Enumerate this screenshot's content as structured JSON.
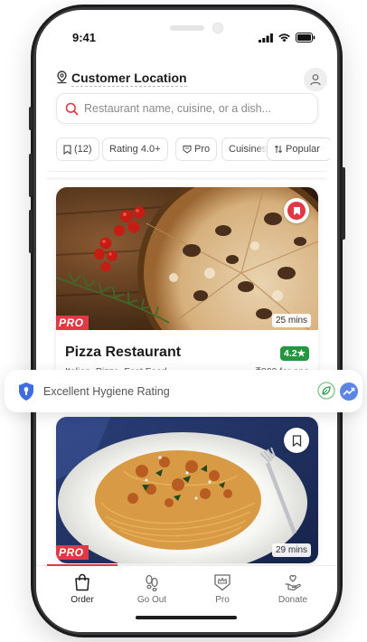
{
  "status": {
    "time": "9:41"
  },
  "header": {
    "location_title": "Customer Location"
  },
  "search": {
    "placeholder": "Restaurant name, cuisine, or a dish..."
  },
  "filters": [
    {
      "label": "(12)",
      "icon": "bookmark-icon"
    },
    {
      "label": "Rating 4.0+"
    },
    {
      "label": "Pro",
      "icon": "pro-shield-icon"
    },
    {
      "label": "Cuisines"
    },
    {
      "label": "Popular",
      "icon": "sort-arrows-icon"
    }
  ],
  "restaurants": [
    {
      "name": "Pizza Restaurant",
      "rating": "4.2★",
      "cuisines": "Italian, Pizza, Fast Food",
      "price": "₹800 for one",
      "eta": "25 mins",
      "badge": "PRO",
      "bookmarked": true
    },
    {
      "name": "",
      "eta": "29 mins",
      "badge": "PRO",
      "bookmarked": false
    }
  ],
  "hygiene": {
    "label": "Excellent Hygiene Rating"
  },
  "tabs": [
    {
      "label": "Order",
      "icon": "shopping-bag-icon",
      "active": true
    },
    {
      "label": "Go Out",
      "icon": "footprints-icon",
      "active": false
    },
    {
      "label": "Pro",
      "icon": "crown-shield-icon",
      "active": false
    },
    {
      "label": "Donate",
      "icon": "heart-hand-icon",
      "active": false
    }
  ],
  "colors": {
    "accent": "#e23744",
    "rating_green": "#24963f"
  }
}
